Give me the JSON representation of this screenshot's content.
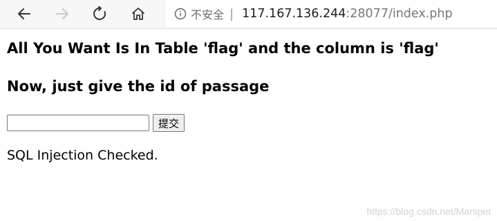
{
  "browser": {
    "icons": {
      "back": "back-arrow-icon",
      "forward": "forward-arrow-icon",
      "refresh": "refresh-icon",
      "home": "home-icon",
      "info": "info-icon"
    },
    "security_label": "不安全",
    "separator": "|",
    "url_host": "117.167.136.244",
    "url_rest": ":28077/index.php"
  },
  "page": {
    "heading1": "All You Want Is In Table 'flag' and the column is 'flag'",
    "heading2": "Now, just give the id of passage",
    "input_value": "",
    "submit_label": "提交",
    "result_text": "SQL Injection Checked."
  },
  "watermark": "https://blog.csdn.net/Marsper"
}
